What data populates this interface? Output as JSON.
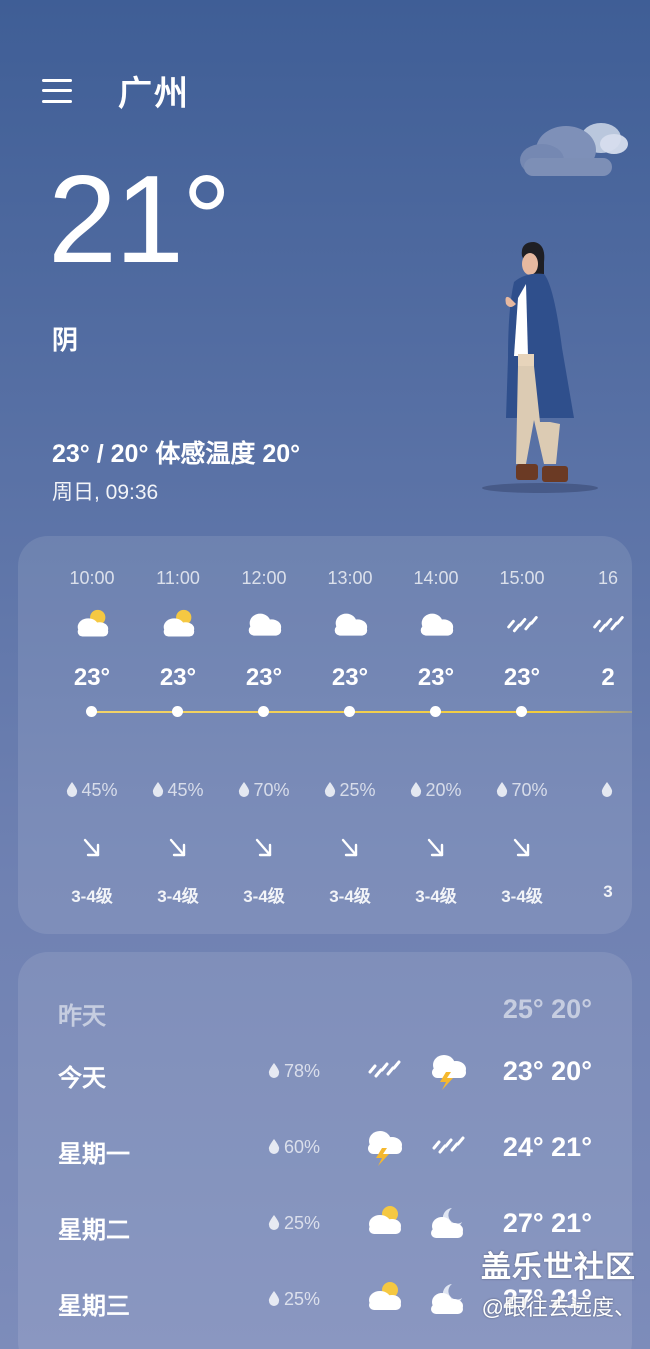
{
  "header": {
    "city": "广州"
  },
  "current": {
    "temp": "21°",
    "condition": "阴",
    "range": "23° / 20° 体感温度 20°",
    "datetime": "周日, 09:36"
  },
  "hourly": [
    {
      "time": "10:00",
      "icon": "partly-cloudy-icon",
      "temp": "23°",
      "rain": "45%",
      "wind": "3-4级"
    },
    {
      "time": "11:00",
      "icon": "partly-cloudy-icon",
      "temp": "23°",
      "rain": "45%",
      "wind": "3-4级"
    },
    {
      "time": "12:00",
      "icon": "cloudy-icon",
      "temp": "23°",
      "rain": "70%",
      "wind": "3-4级"
    },
    {
      "time": "13:00",
      "icon": "cloudy-icon",
      "temp": "23°",
      "rain": "25%",
      "wind": "3-4级"
    },
    {
      "time": "14:00",
      "icon": "cloudy-icon",
      "temp": "23°",
      "rain": "20%",
      "wind": "3-4级"
    },
    {
      "time": "15:00",
      "icon": "rain-icon",
      "temp": "23°",
      "rain": "70%",
      "wind": "3-4级"
    },
    {
      "time": "16",
      "icon": "rain-icon",
      "temp": "2",
      "rain": "",
      "wind": "3"
    }
  ],
  "daily": [
    {
      "name": "昨天",
      "rain": "",
      "icon_day": "",
      "icon_night": "",
      "temps": "25° 20°",
      "dim": true
    },
    {
      "name": "今天",
      "rain": "78%",
      "icon_day": "rain-icon",
      "icon_night": "thunderstorm-icon",
      "temps": "23° 20°",
      "dim": false
    },
    {
      "name": "星期一",
      "rain": "60%",
      "icon_day": "thunderstorm-icon",
      "icon_night": "rain-icon",
      "temps": "24° 21°",
      "dim": false
    },
    {
      "name": "星期二",
      "rain": "25%",
      "icon_day": "partly-cloudy-icon",
      "icon_night": "cloudy-night-icon",
      "temps": "27° 21°",
      "dim": false
    },
    {
      "name": "星期三",
      "rain": "25%",
      "icon_day": "partly-cloudy-icon",
      "icon_night": "cloudy-night-icon",
      "temps": "27° 21°",
      "dim": false
    }
  ],
  "watermark": {
    "main": "盖乐世社区",
    "sub": "@跟往去远度、"
  },
  "colors": {
    "accent_line": "#f2cc3c",
    "sun": "#f5c842",
    "bolt": "#f5b82e"
  }
}
